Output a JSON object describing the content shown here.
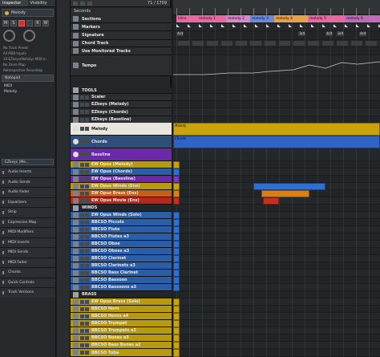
{
  "inspector": {
    "tabs": [
      "Inspector",
      "Visibility"
    ],
    "track_name": "Melody",
    "midi_in": "No Track Preset",
    "io_rows": [
      "All MIDI Inputs",
      "10-EZkeys(Melody)-MIDI In",
      "No Drum Map",
      "Retrospective Recording"
    ],
    "notepad_label": "Notepad",
    "notepad_text": [
      "MIDI",
      "Melody"
    ],
    "plugin_slot": "EZkeys (Me...",
    "sections": [
      "Audio Inserts",
      "Audio Sends",
      "Audio Fader",
      "Equalizers",
      "Strip",
      "Expression Map",
      "MIDI Modifiers",
      "MIDI Inserts",
      "MIDI Sends",
      "MIDI Fader",
      "Chords",
      "Quick Controls",
      "Track Versions"
    ]
  },
  "tracklist": {
    "time_label": "Seconds",
    "counter": "71 / 1709",
    "tracks": [
      {
        "name": "Sections",
        "color": "#2d3134",
        "kind": "global"
      },
      {
        "name": "Markers",
        "color": "#2d3134",
        "kind": "global"
      },
      {
        "name": "Signature",
        "color": "#2d3134",
        "kind": "global"
      },
      {
        "name": "Chord Track",
        "color": "#2d3134",
        "kind": "global"
      },
      {
        "name": "Use Monitored Tracks",
        "color": "#2d3134",
        "kind": "global"
      },
      {
        "name": "Tempo",
        "color": "#2d3134",
        "kind": "global"
      },
      {
        "name": "TOOLS",
        "color": "#26292c",
        "kind": "folder"
      },
      {
        "name": "Scaler",
        "color": "#2a2e31",
        "kind": "inst"
      },
      {
        "name": "EZkeys (Melody)",
        "color": "#2a2e31",
        "kind": "inst"
      },
      {
        "name": "EZkeys (Chords)",
        "color": "#2a2e31",
        "kind": "inst"
      },
      {
        "name": "EZkeys (Bassline)",
        "color": "#2a2e31",
        "kind": "inst"
      },
      {
        "name": "Melody",
        "color": "#e8e6dc",
        "kind": "midi"
      },
      {
        "name": "Chords",
        "color": "#2f4f7a",
        "kind": "midi"
      },
      {
        "name": "Bassline",
        "color": "#6a2aa8",
        "kind": "midi"
      },
      {
        "name": "EW Opus (Melody)",
        "color": "#b89a10",
        "kind": "inst"
      },
      {
        "name": "EW Opus (Chords)",
        "color": "#2a5ea6",
        "kind": "inst"
      },
      {
        "name": "EW Opus (Bassline)",
        "color": "#6a2aa8",
        "kind": "inst"
      },
      {
        "name": "EW Opus Winds (Ens)",
        "color": "#b89a10",
        "kind": "inst"
      },
      {
        "name": "EW Opus Brass (Ens)",
        "color": "#c0601a",
        "kind": "inst"
      },
      {
        "name": "EW Opus Movie (Ens)",
        "color": "#b8281a",
        "kind": "inst"
      },
      {
        "name": "WINDS",
        "color": "#26292c",
        "kind": "folder"
      },
      {
        "name": "EW Opus Winds (Solo)",
        "color": "#2a5ea6",
        "kind": "inst"
      },
      {
        "name": "BBCSO Piccolo",
        "color": "#2a5ea6",
        "kind": "inst"
      },
      {
        "name": "BBCSO Flute",
        "color": "#2a5ea6",
        "kind": "inst"
      },
      {
        "name": "BBCSO Flutes a3",
        "color": "#2a5ea6",
        "kind": "inst"
      },
      {
        "name": "BBCSO Oboe",
        "color": "#2a5ea6",
        "kind": "inst"
      },
      {
        "name": "BBCSO Oboes a3",
        "color": "#2a5ea6",
        "kind": "inst"
      },
      {
        "name": "BBCSO Clarinet",
        "color": "#2a5ea6",
        "kind": "inst"
      },
      {
        "name": "BBCSO Clarinets a3",
        "color": "#2a5ea6",
        "kind": "inst"
      },
      {
        "name": "BBCSO Bass Clarinet",
        "color": "#2a5ea6",
        "kind": "inst"
      },
      {
        "name": "BBCSO Bassoon",
        "color": "#2a5ea6",
        "kind": "inst"
      },
      {
        "name": "BBCSO Bassoons a3",
        "color": "#2a5ea6",
        "kind": "inst"
      },
      {
        "name": "BRASS",
        "color": "#26292c",
        "kind": "folder"
      },
      {
        "name": "EW Opus Brass (Solo)",
        "color": "#b89a10",
        "kind": "inst"
      },
      {
        "name": "BBCSO Horn",
        "color": "#b89a10",
        "kind": "inst"
      },
      {
        "name": "BBCSO Horns a4",
        "color": "#b89a10",
        "kind": "inst"
      },
      {
        "name": "BBCSO Trumpet",
        "color": "#b89a10",
        "kind": "inst"
      },
      {
        "name": "BBCSO Trumpets a3",
        "color": "#b89a10",
        "kind": "inst"
      },
      {
        "name": "BBCSO Bones a3",
        "color": "#b89a10",
        "kind": "inst"
      },
      {
        "name": "BBCSO Bass Bones a2",
        "color": "#b89a10",
        "kind": "inst"
      },
      {
        "name": "BBCSO Tuba",
        "color": "#b89a10",
        "kind": "inst"
      }
    ]
  },
  "arranger": {
    "sections": [
      {
        "label": "Intro",
        "color": "#e46aa0"
      },
      {
        "label": "melody 1",
        "color": "#e46aa0"
      },
      {
        "label": "melody 2",
        "color": "#d887c8"
      },
      {
        "label": "melody 3",
        "color": "#6a8ad8"
      },
      {
        "label": "melody 4",
        "color": "#e4a04a"
      },
      {
        "label": "melody 5",
        "color": "#e46aa0"
      },
      {
        "label": "melody 6",
        "color": "#c06ab8"
      }
    ],
    "signatures": [
      "4/4",
      "3/4",
      "4/4",
      "3/4",
      "4/4"
    ],
    "event_labels": {
      "melody": "Melody",
      "chords": "Chords"
    }
  },
  "colors": {
    "melody_event": "#c9a20e",
    "chords_event": "#2f63c4",
    "opus_event": "#2f6fd0",
    "brass_event": "#d6801a"
  }
}
